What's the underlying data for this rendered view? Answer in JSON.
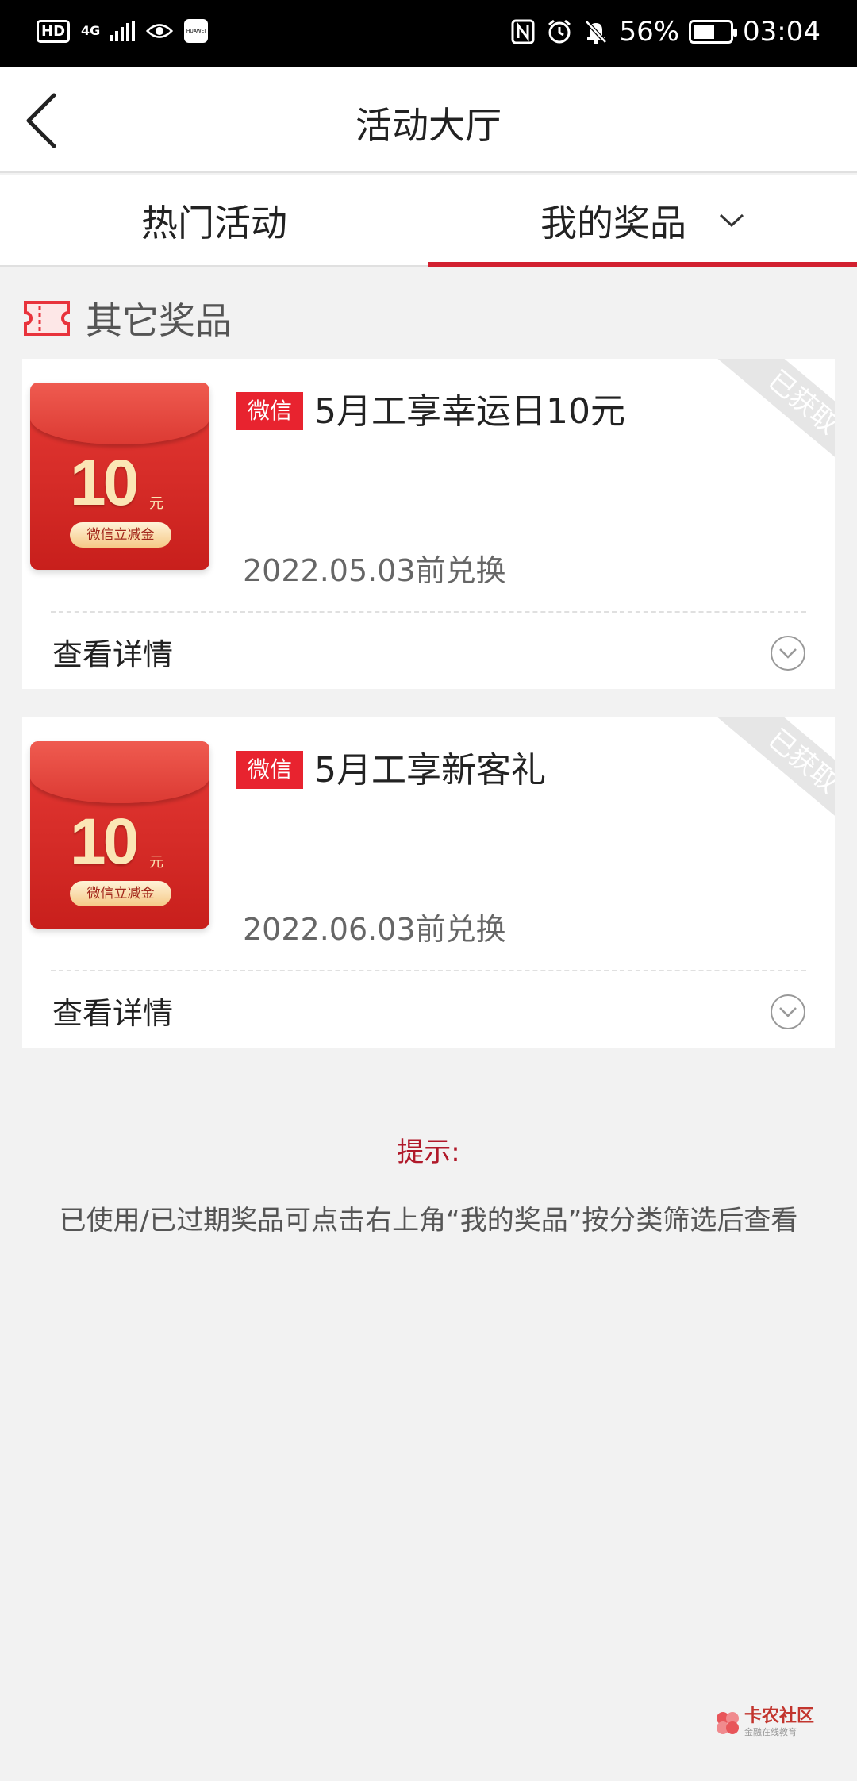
{
  "status_bar": {
    "hd": "HD",
    "network": "4G",
    "battery_percent": "56%",
    "time": "03:04",
    "icons": [
      "hd-icon",
      "signal-icon",
      "eye-icon",
      "huawei-icon",
      "nfc-icon",
      "alarm-icon",
      "mute-icon",
      "battery-icon"
    ]
  },
  "header": {
    "title": "活动大厅",
    "back_icon": "back-arrow-icon"
  },
  "tabs": [
    {
      "label": "热门活动",
      "active": false
    },
    {
      "label": "我的奖品",
      "active": true
    }
  ],
  "section": {
    "title": "其它奖品",
    "icon": "ticket-icon"
  },
  "prizes": [
    {
      "envelope_amount": "10",
      "envelope_unit": "元",
      "envelope_tag": "微信立减金",
      "badge": "微信",
      "name": "5月工享幸运日10元",
      "deadline": "2022.05.03前兑换",
      "status": "已获取",
      "details_label": "查看详情"
    },
    {
      "envelope_amount": "10",
      "envelope_unit": "元",
      "envelope_tag": "微信立减金",
      "badge": "微信",
      "name": "5月工享新客礼",
      "deadline": "2022.06.03前兑换",
      "status": "已获取",
      "details_label": "查看详情"
    }
  ],
  "tip": {
    "title": "提示:",
    "text": "已使用/已过期奖品可点击右上角“我的奖品”按分类筛选后查看"
  },
  "watermark": {
    "main": "卡农社区",
    "sub": "金融在线教育"
  },
  "colors": {
    "accent": "#d22030",
    "badge": "#e8232f",
    "tip": "#b0192a",
    "background": "#f2f2f2"
  }
}
